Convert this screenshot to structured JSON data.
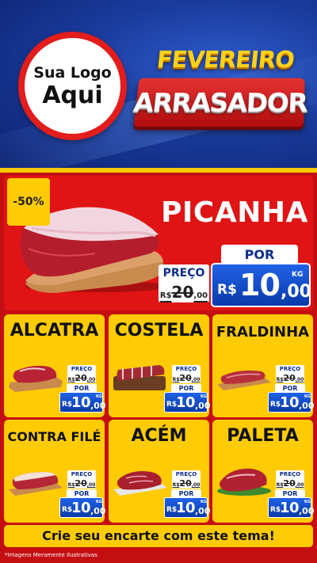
{
  "header": {
    "logo_line1": "Sua Logo",
    "logo_line2": "Aqui",
    "title_top": "FEVEREIRO",
    "title_bottom": "ARRASADOR"
  },
  "colors": {
    "brand_red": "#c40f12",
    "brand_yellow": "#ffcb05",
    "price_blue": "#0b3aa8",
    "header_blue": "#1a3c9e"
  },
  "hero": {
    "discount": "-50%",
    "name": "PICANHA",
    "old_label": "PREÇO",
    "old_currency": "R$",
    "old_int": "20",
    "old_dec": ",00",
    "new_label": "POR",
    "currency": "R$",
    "price_int": "10",
    "price_dec": ",00",
    "unit": "KG"
  },
  "products": [
    {
      "name": "ALCATRA",
      "old_label": "PREÇO",
      "old_currency": "R$",
      "old_int": "20",
      "old_dec": ",00",
      "new_label": "POR",
      "currency": "R$",
      "price_int": "10",
      "price_dec": ",00",
      "unit": "KG"
    },
    {
      "name": "COSTELA",
      "old_label": "PREÇO",
      "old_currency": "R$",
      "old_int": "20",
      "old_dec": ",00",
      "new_label": "POR",
      "currency": "R$",
      "price_int": "10",
      "price_dec": ",00",
      "unit": "KG"
    },
    {
      "name": "FRALDINHA",
      "old_label": "PREÇO",
      "old_currency": "R$",
      "old_int": "20",
      "old_dec": ",00",
      "new_label": "POR",
      "currency": "R$",
      "price_int": "10",
      "price_dec": ",00",
      "unit": "KG"
    },
    {
      "name": "CONTRA FILÉ",
      "old_label": "PREÇO",
      "old_currency": "R$",
      "old_int": "20",
      "old_dec": ",00",
      "new_label": "POR",
      "currency": "R$",
      "price_int": "10",
      "price_dec": ",00",
      "unit": "KG"
    },
    {
      "name": "ACÉM",
      "old_label": "PREÇO",
      "old_currency": "R$",
      "old_int": "20",
      "old_dec": ",00",
      "new_label": "POR",
      "currency": "R$",
      "price_int": "10",
      "price_dec": ",00",
      "unit": "KG"
    },
    {
      "name": "PALETA",
      "old_label": "PREÇO",
      "old_currency": "R$",
      "old_int": "20",
      "old_dec": ",00",
      "new_label": "POR",
      "currency": "R$",
      "price_int": "10",
      "price_dec": ",00",
      "unit": "KG"
    }
  ],
  "cta": "Crie seu encarte com este tema!",
  "footnote": "*Imagens Meramente Ilustrativas"
}
